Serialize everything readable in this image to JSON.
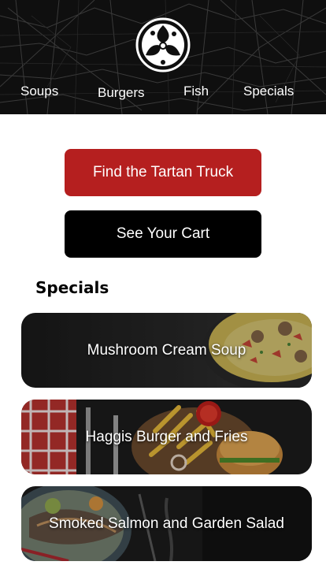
{
  "nav": {
    "items": [
      "Soups",
      "Burgers",
      "Fish",
      "Specials"
    ]
  },
  "actions": {
    "find_truck": "Find the Tartan Truck",
    "see_cart": "See Your Cart"
  },
  "specials": {
    "title": "Specials",
    "items": [
      "Mushroom Cream Soup",
      "Haggis Burger and Fries",
      "Smoked Salmon and Garden Salad"
    ]
  },
  "colors": {
    "accent": "#b51f1f",
    "header_bg": "#0f0f0f",
    "button_dark": "#000000"
  }
}
